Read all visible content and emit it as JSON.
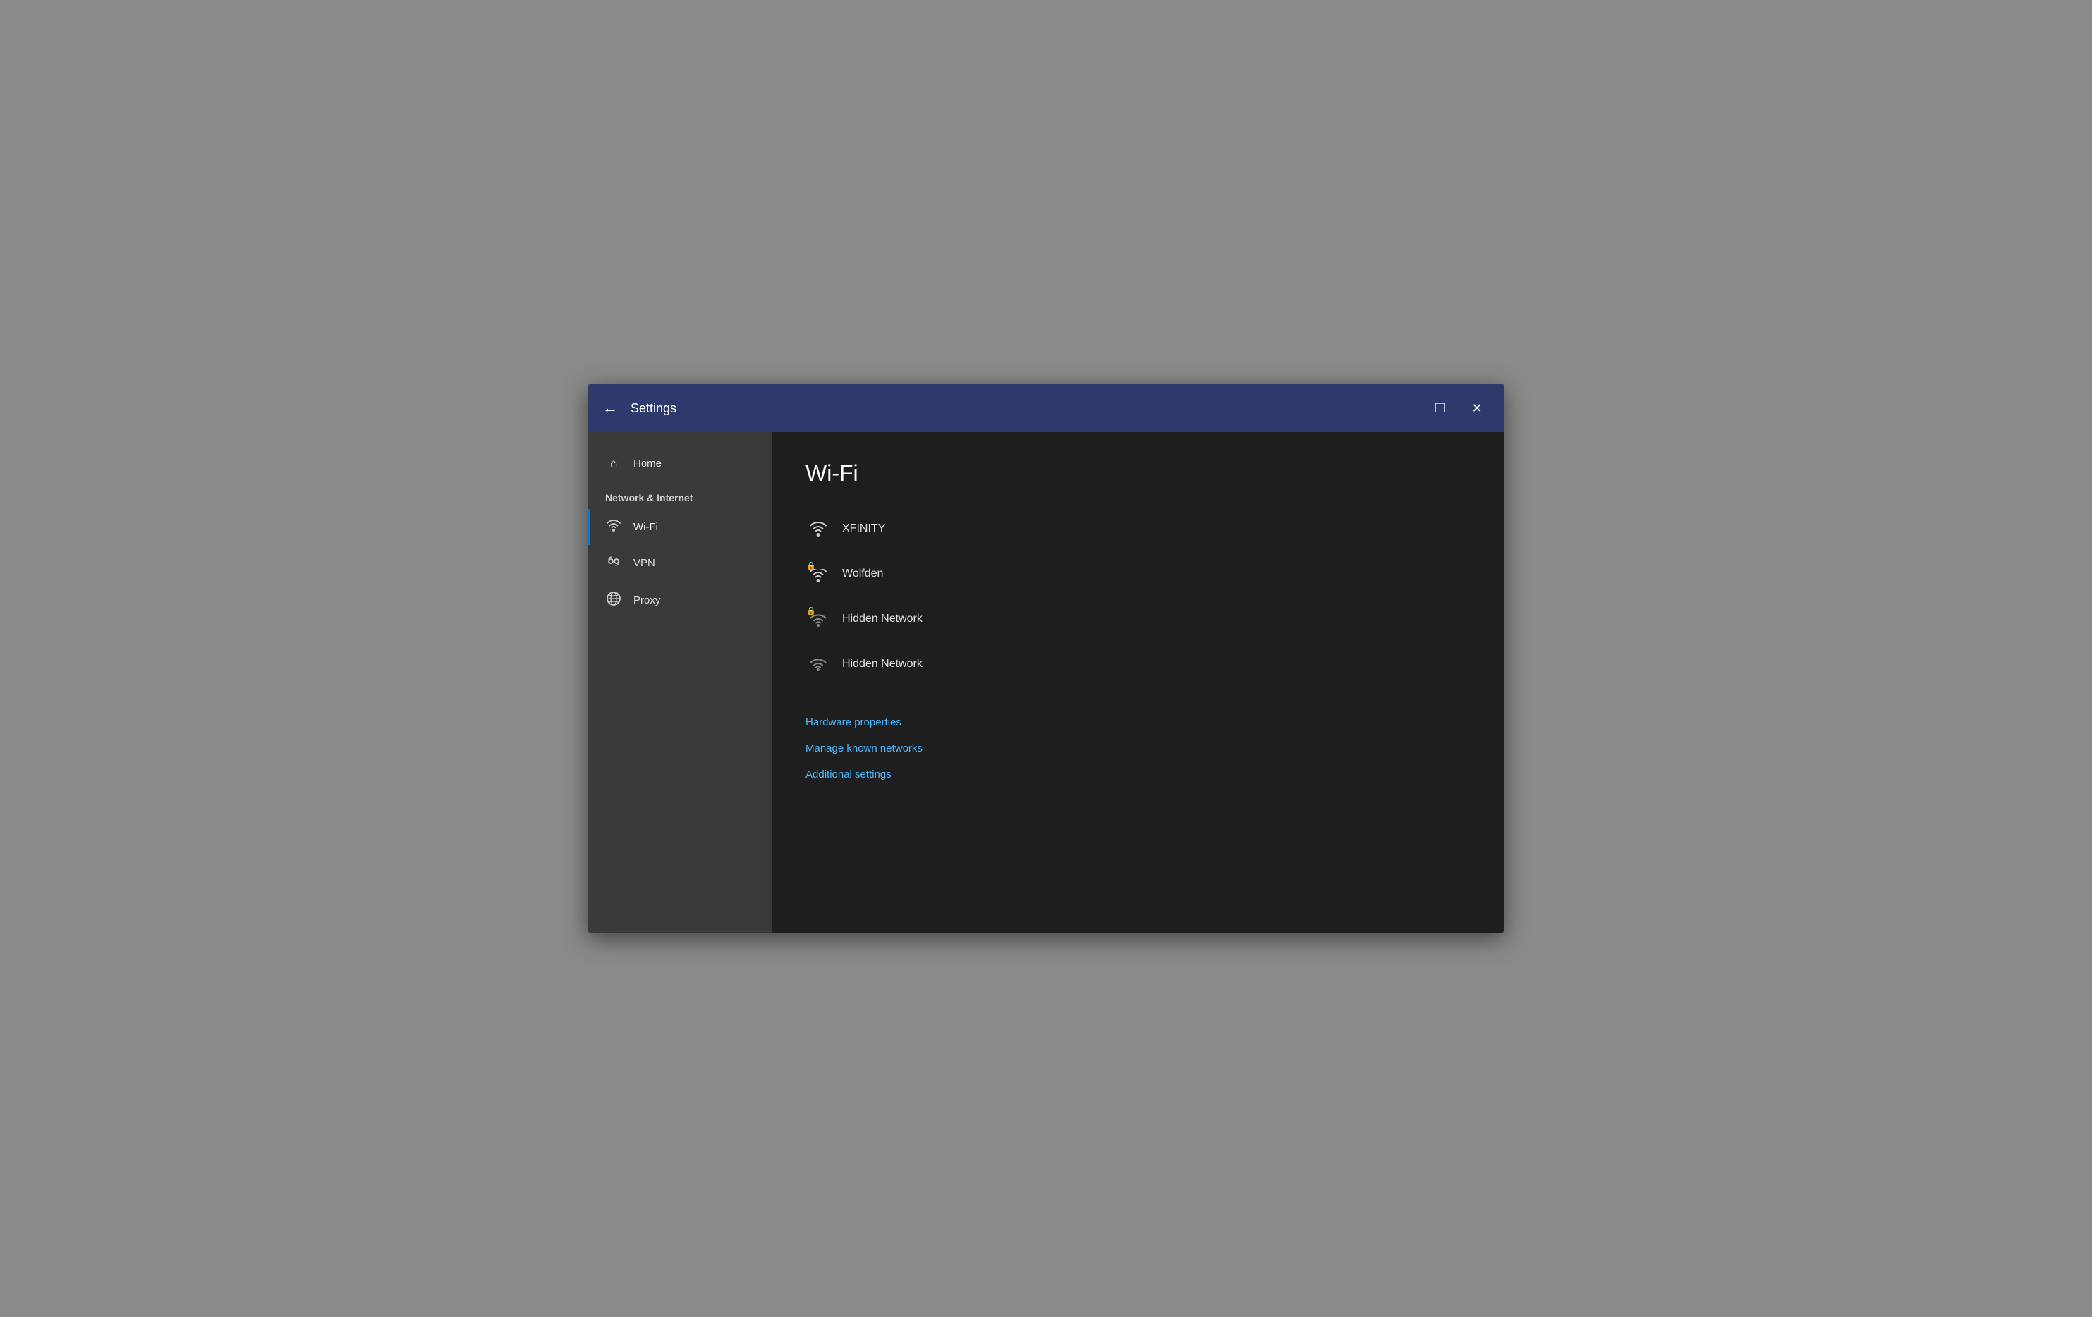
{
  "titlebar": {
    "back_label": "←",
    "title": "Settings",
    "restore_label": "❒",
    "close_label": "✕"
  },
  "sidebar": {
    "home_label": "Home",
    "section_label": "Network & Internet",
    "items": [
      {
        "id": "wifi",
        "label": "Wi-Fi",
        "icon": "wifi",
        "active": true
      },
      {
        "id": "vpn",
        "label": "VPN",
        "icon": "vpn",
        "active": false
      },
      {
        "id": "proxy",
        "label": "Proxy",
        "icon": "proxy",
        "active": false
      }
    ]
  },
  "main": {
    "title": "Wi-Fi",
    "networks": [
      {
        "name": "XFINITY",
        "locked": false,
        "signal": "full"
      },
      {
        "name": "Wolfden",
        "locked": true,
        "signal": "full"
      },
      {
        "name": "Hidden Network",
        "locked": true,
        "signal": "low"
      },
      {
        "name": "Hidden Network",
        "locked": false,
        "signal": "low"
      }
    ],
    "links": [
      {
        "label": "Hardware properties"
      },
      {
        "label": "Manage known networks"
      },
      {
        "label": "Additional settings"
      }
    ]
  }
}
